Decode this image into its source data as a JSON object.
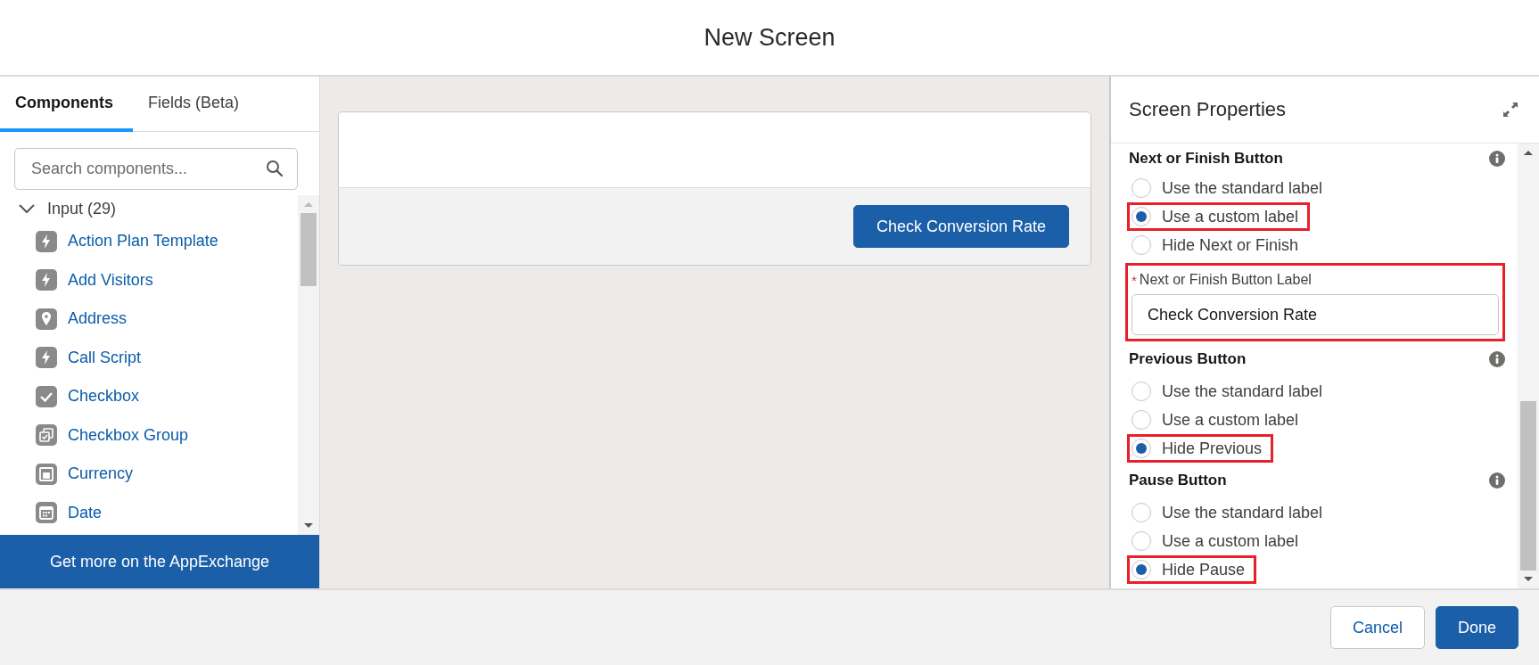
{
  "dialog": {
    "title": "New Screen"
  },
  "tabs": [
    {
      "label": "Components",
      "selected": true
    },
    {
      "label": "Fields (Beta)",
      "selected": false
    }
  ],
  "search": {
    "placeholder": "Search components..."
  },
  "group": {
    "label": "Input (29)",
    "expanded": true,
    "items": [
      {
        "label": "Action Plan Template",
        "kind": "flash"
      },
      {
        "label": "Add Visitors",
        "kind": "flash"
      },
      {
        "label": "Address",
        "kind": "pin"
      },
      {
        "label": "Call Script",
        "kind": "flash"
      },
      {
        "label": "Checkbox",
        "kind": "check"
      },
      {
        "label": "Checkbox Group",
        "kind": "checkgroup"
      },
      {
        "label": "Currency",
        "kind": "currency"
      },
      {
        "label": "Date",
        "kind": "calendar"
      }
    ]
  },
  "appexchange_button": "Get more on the AppExchange",
  "canvas": {
    "button": "Check Conversion Rate"
  },
  "properties": {
    "title": "Screen Properties",
    "sections": [
      {
        "heading": "Next or Finish Button",
        "options": [
          {
            "label": "Use the standard label",
            "selected": false,
            "highlighted": false
          },
          {
            "label": "Use a custom label",
            "selected": true,
            "highlighted": true
          },
          {
            "label": "Hide Next or Finish",
            "selected": false,
            "highlighted": false
          }
        ],
        "field": {
          "required_mark": "*",
          "label": "Next or Finish Button Label",
          "value": "Check Conversion Rate",
          "highlighted": true
        }
      },
      {
        "heading": "Previous Button",
        "options": [
          {
            "label": "Use the standard label",
            "selected": false,
            "highlighted": false
          },
          {
            "label": "Use a custom label",
            "selected": false,
            "highlighted": false
          },
          {
            "label": "Hide Previous",
            "selected": true,
            "highlighted": true
          }
        ]
      },
      {
        "heading": "Pause Button",
        "options": [
          {
            "label": "Use the standard label",
            "selected": false,
            "highlighted": false
          },
          {
            "label": "Use a custom label",
            "selected": false,
            "highlighted": false
          },
          {
            "label": "Hide Pause",
            "selected": true,
            "highlighted": true
          }
        ]
      }
    ]
  },
  "footer": {
    "buttons": [
      {
        "label": "Cancel",
        "kind": "neutral"
      },
      {
        "label": "Done",
        "kind": "brand"
      }
    ]
  }
}
